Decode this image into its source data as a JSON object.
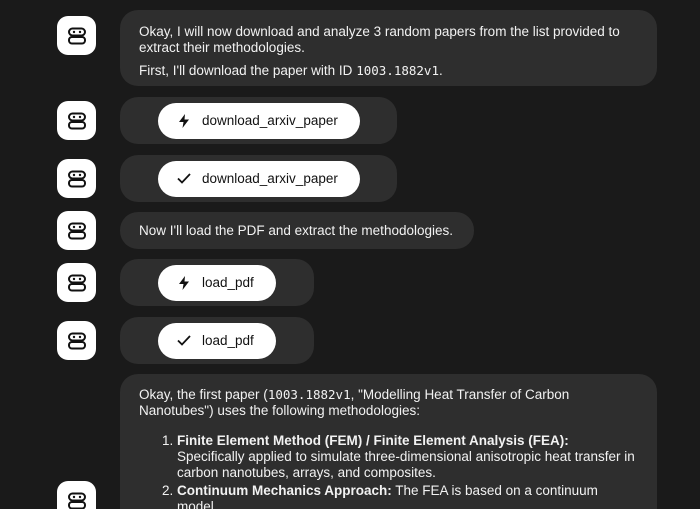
{
  "messages": {
    "m1": {
      "line1": "Okay, I will now download and analyze 3 random papers from the list provided to extract their methodologies.",
      "line2_pre": "First, I'll download the paper with ID ",
      "line2_code": "1003.1882v1",
      "line2_post": "."
    },
    "tool1": {
      "label": "download_arxiv_paper",
      "icon": "bolt-icon"
    },
    "tool2": {
      "label": "download_arxiv_paper",
      "icon": "check-icon"
    },
    "m2": {
      "text": "Now I'll load the PDF and extract the methodologies."
    },
    "tool3": {
      "label": "load_pdf",
      "icon": "bolt-icon"
    },
    "tool4": {
      "label": "load_pdf",
      "icon": "check-icon"
    },
    "m3": {
      "intro_pre": "Okay, the first paper (",
      "intro_code": "1003.1882v1",
      "intro_post": ", \"Modelling Heat Transfer of Carbon Nanotubes\") uses the following methodologies:",
      "items": [
        {
          "title": "Finite Element Method (FEM) / Finite Element Analysis (FEA):",
          "text": " Specifically applied to simulate three-dimensional anisotropic heat transfer in carbon nanotubes, arrays, and composites."
        },
        {
          "title": "Continuum Mechanics Approach:",
          "text": " The FEA is based on a continuum model."
        }
      ]
    }
  },
  "colors": {
    "background": "#1a1a1a",
    "bubble": "#2e2e2e",
    "pill": "#ffffff",
    "text": "#f2f2f2"
  }
}
